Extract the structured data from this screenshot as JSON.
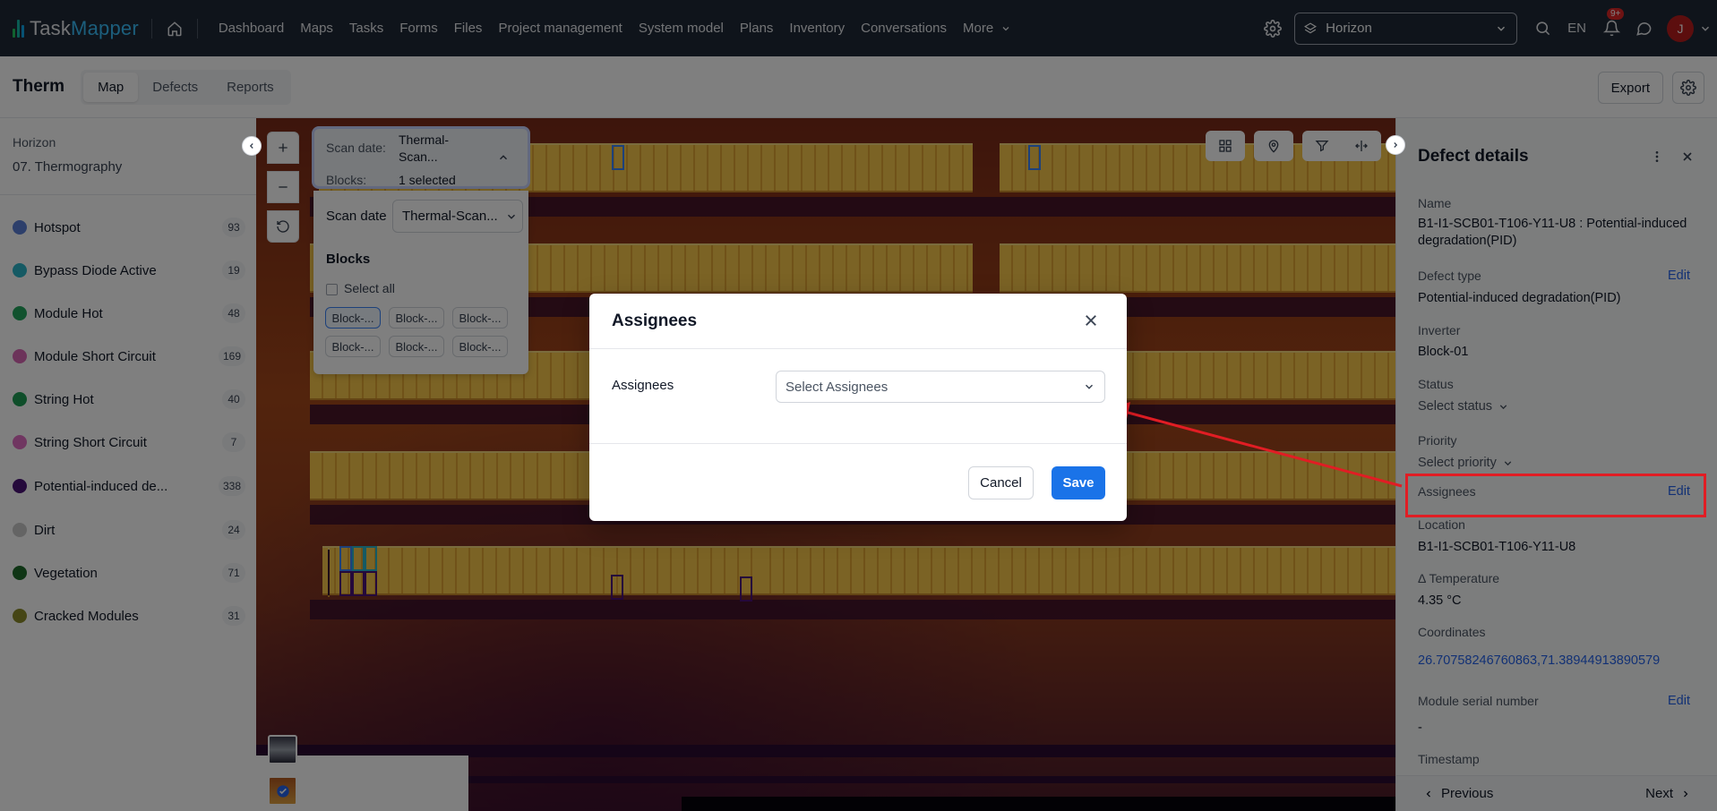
{
  "nav": {
    "logo_task": "Task",
    "logo_mapper": "Mapper",
    "links": [
      "Dashboard",
      "Maps",
      "Tasks",
      "Forms",
      "Files",
      "Project management",
      "System model",
      "Plans",
      "Inventory",
      "Conversations",
      "More"
    ],
    "project": "Horizon",
    "lang": "EN",
    "notif_badge": "9+",
    "avatar_letter": "J"
  },
  "subheader": {
    "title": "Therm",
    "tabs": [
      "Map",
      "Defects",
      "Reports"
    ],
    "active_tab": "Map",
    "export_label": "Export"
  },
  "sidebar": {
    "breadcrumb_project": "Horizon",
    "breadcrumb_view": "07. Thermography",
    "defects": [
      {
        "label": "Hotspot",
        "count": "93",
        "color": "#5b7fd6"
      },
      {
        "label": "Bypass Diode Active",
        "count": "19",
        "color": "#2bb5c9"
      },
      {
        "label": "Module Hot",
        "count": "48",
        "color": "#22a45d"
      },
      {
        "label": "Module Short Circuit",
        "count": "169",
        "color": "#d966b5"
      },
      {
        "label": "String Hot",
        "count": "40",
        "color": "#1f9d55"
      },
      {
        "label": "String Short Circuit",
        "count": "7",
        "color": "#e06cc2"
      },
      {
        "label": "Potential-induced de...",
        "count": "338",
        "color": "#4a1377"
      },
      {
        "label": "Dirt",
        "count": "24",
        "color": "#c8c8c8"
      },
      {
        "label": "Vegetation",
        "count": "71",
        "color": "#1e6b2a"
      },
      {
        "label": "Cracked Modules",
        "count": "31",
        "color": "#8b8b2a"
      }
    ]
  },
  "filter": {
    "scan_date_label": "Scan date:",
    "scan_date_value": "Thermal-Scan...",
    "blocks_label": "Blocks:",
    "blocks_value": "1 selected",
    "dropdown_scan_label": "Scan date",
    "dropdown_scan_value": "Thermal-Scan...",
    "blocks_heading": "Blocks",
    "select_all": "Select all",
    "chips": [
      "Block-...",
      "Block-...",
      "Block-...",
      "Block-...",
      "Block-...",
      "Block-..."
    ]
  },
  "details": {
    "title": "Defect details",
    "name_label": "Name",
    "name_value_line1": "B1-I1-SCB01-T106-Y11-U8 : Potential-induced",
    "name_value_line2": "degradation(PID)",
    "defect_type_label": "Defect type",
    "defect_type_value": "Potential-induced degradation(PID)",
    "inverter_label": "Inverter",
    "inverter_value": "Block-01",
    "status_label": "Status",
    "status_value": "Select status",
    "priority_label": "Priority",
    "priority_value": "Select priority",
    "assignees_label": "Assignees",
    "location_label": "Location",
    "location_value": "B1-I1-SCB01-T106-Y11-U8",
    "temperature_label": "Δ Temperature",
    "temperature_value": "4.35 °C",
    "coordinates_label": "Coordinates",
    "coordinates_value": "26.70758246760863,71.38944913890579",
    "serial_label": "Module serial number",
    "serial_value": "-",
    "timestamp_label": "Timestamp",
    "edit_label": "Edit",
    "prev_label": "Previous",
    "next_label": "Next"
  },
  "modal": {
    "title": "Assignees",
    "field_label": "Assignees",
    "placeholder": "Select Assignees",
    "cancel_label": "Cancel",
    "save_label": "Save"
  },
  "colors": {
    "accent": "#1a73e8",
    "nav_bg": "#1f2937",
    "highlight": "#e11d24"
  }
}
